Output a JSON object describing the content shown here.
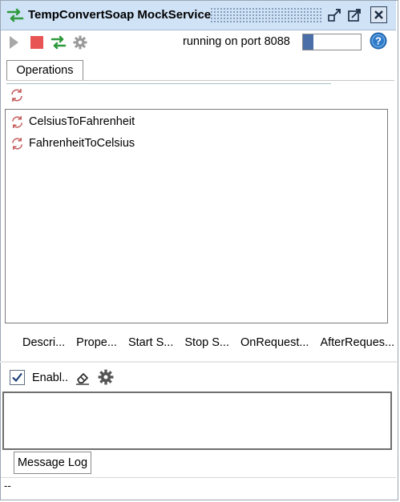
{
  "window": {
    "title": "TempConvertSoap MockService",
    "title_icon": "mockservice-icon",
    "controls": [
      "undock-icon",
      "maximize-icon",
      "close-icon"
    ]
  },
  "toolbar": {
    "run_icon": "play-icon",
    "stop_icon": "stop-icon",
    "restart_icon": "restart-arrows-icon",
    "options_icon": "gear-icon",
    "status": "running on port 8088",
    "progress_fraction": 0.18,
    "help_icon": "help-icon"
  },
  "tabs": {
    "operations": "Operations"
  },
  "operations": [
    {
      "name": "CelsiusToFahrenheit",
      "icon": "operation-icon"
    },
    {
      "name": "FahrenheitToCelsius",
      "icon": "operation-icon"
    }
  ],
  "bottom_tabs": [
    "Descri...",
    "Prope...",
    "Start S...",
    "Stop S...",
    "OnRequest...",
    "AfterReques..."
  ],
  "script": {
    "enable_label": "Enabl..",
    "enabled": true
  },
  "log": {
    "tab_label": "Message Log"
  },
  "statusbar": {
    "text": "--"
  },
  "colors": {
    "titlebar_bg": "#cfe2f6",
    "accent_green": "#2e9a3c",
    "stop_red": "#e85454",
    "progress_fill": "#4a6ea7",
    "help_blue": "#2f7bc9"
  }
}
